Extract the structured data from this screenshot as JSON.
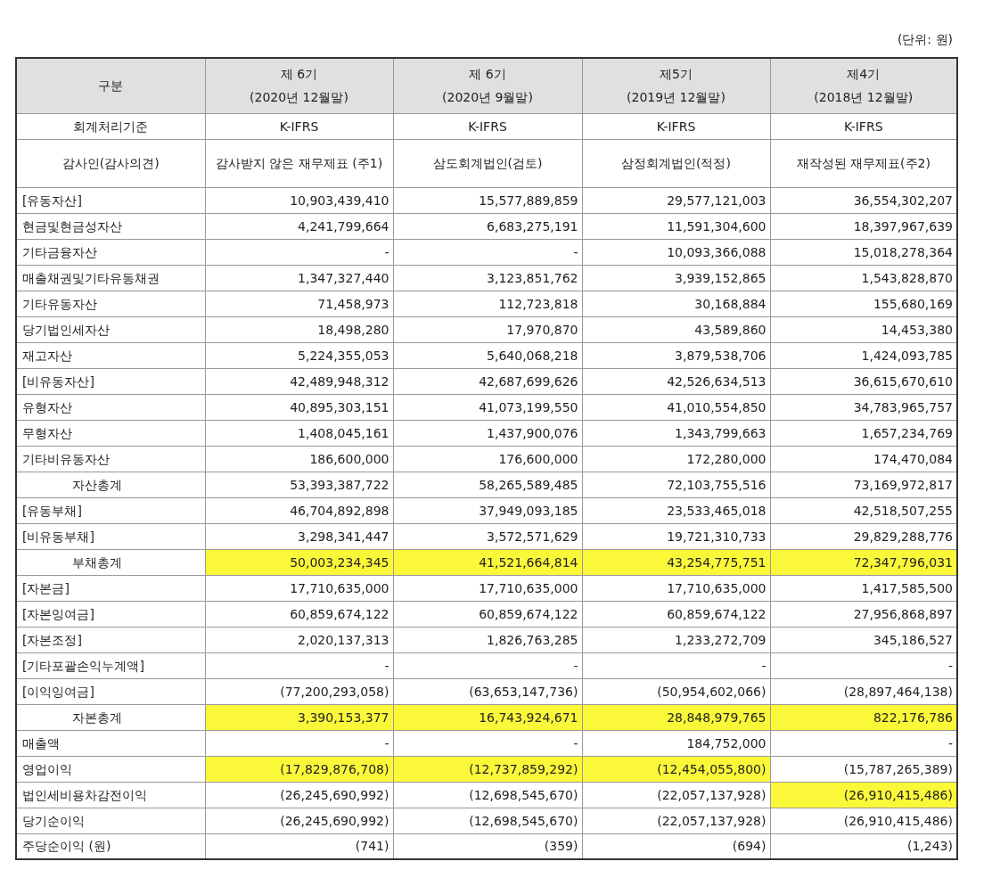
{
  "unit_note": "(단위: 원)",
  "columns": [
    {
      "label": "구분"
    },
    {
      "period": "제 6기",
      "date": "(2020년 12월말)"
    },
    {
      "period": "제 6기",
      "date": "(2020년 9월말)"
    },
    {
      "period": "제5기",
      "date": "(2019년 12월말)"
    },
    {
      "period": "제4기",
      "date": "(2018년 12월말)"
    }
  ],
  "rows": [
    {
      "kind": "info",
      "label": "회계처리기준",
      "cells": [
        {
          "text": "K-IFRS",
          "highlighted": false
        },
        {
          "text": "K-IFRS",
          "highlighted": false
        },
        {
          "text": "K-IFRS",
          "highlighted": false
        },
        {
          "text": "K-IFRS",
          "highlighted": false
        }
      ]
    },
    {
      "kind": "info",
      "label": "감사인(감사의견)",
      "cells": [
        {
          "text": "감사받지 않은 재무제표 (주1)",
          "highlighted": false
        },
        {
          "text": "삼도회계법인(검토)",
          "highlighted": false
        },
        {
          "text": "삼정회계법인(적정)",
          "highlighted": false
        },
        {
          "text": "재작성된 재무제표(주2)",
          "highlighted": false
        }
      ]
    },
    {
      "kind": "item",
      "label": "[유동자산]",
      "cells": [
        {
          "text": "10,903,439,410",
          "highlighted": false
        },
        {
          "text": "15,577,889,859",
          "highlighted": false
        },
        {
          "text": "29,577,121,003",
          "highlighted": false
        },
        {
          "text": "36,554,302,207",
          "highlighted": false
        }
      ]
    },
    {
      "kind": "item",
      "label": "현금및현금성자산",
      "cells": [
        {
          "text": "4,241,799,664",
          "highlighted": false
        },
        {
          "text": "6,683,275,191",
          "highlighted": false
        },
        {
          "text": "11,591,304,600",
          "highlighted": false
        },
        {
          "text": "18,397,967,639",
          "highlighted": false
        }
      ]
    },
    {
      "kind": "item",
      "label": "기타금융자산",
      "cells": [
        {
          "text": "-",
          "highlighted": false
        },
        {
          "text": "-",
          "highlighted": false
        },
        {
          "text": "10,093,366,088",
          "highlighted": false
        },
        {
          "text": "15,018,278,364",
          "highlighted": false
        }
      ]
    },
    {
      "kind": "item",
      "label": "매출채권및기타유동채권",
      "cells": [
        {
          "text": "1,347,327,440",
          "highlighted": false
        },
        {
          "text": "3,123,851,762",
          "highlighted": false
        },
        {
          "text": "3,939,152,865",
          "highlighted": false
        },
        {
          "text": "1,543,828,870",
          "highlighted": false
        }
      ]
    },
    {
      "kind": "item",
      "label": "기타유동자산",
      "cells": [
        {
          "text": "71,458,973",
          "highlighted": false
        },
        {
          "text": "112,723,818",
          "highlighted": false
        },
        {
          "text": "30,168,884",
          "highlighted": false
        },
        {
          "text": "155,680,169",
          "highlighted": false
        }
      ]
    },
    {
      "kind": "item",
      "label": "당기법인세자산",
      "cells": [
        {
          "text": "18,498,280",
          "highlighted": false
        },
        {
          "text": "17,970,870",
          "highlighted": false
        },
        {
          "text": "43,589,860",
          "highlighted": false
        },
        {
          "text": "14,453,380",
          "highlighted": false
        }
      ]
    },
    {
      "kind": "item",
      "label": "재고자산",
      "cells": [
        {
          "text": "5,224,355,053",
          "highlighted": false
        },
        {
          "text": "5,640,068,218",
          "highlighted": false
        },
        {
          "text": "3,879,538,706",
          "highlighted": false
        },
        {
          "text": "1,424,093,785",
          "highlighted": false
        }
      ]
    },
    {
      "kind": "item",
      "label": "[비유동자산]",
      "cells": [
        {
          "text": "42,489,948,312",
          "highlighted": false
        },
        {
          "text": "42,687,699,626",
          "highlighted": false
        },
        {
          "text": "42,526,634,513",
          "highlighted": false
        },
        {
          "text": "36,615,670,610",
          "highlighted": false
        }
      ]
    },
    {
      "kind": "item",
      "label": "유형자산",
      "cells": [
        {
          "text": "40,895,303,151",
          "highlighted": false
        },
        {
          "text": "41,073,199,550",
          "highlighted": false
        },
        {
          "text": "41,010,554,850",
          "highlighted": false
        },
        {
          "text": "34,783,965,757",
          "highlighted": false
        }
      ]
    },
    {
      "kind": "item",
      "label": "무형자산",
      "cells": [
        {
          "text": "1,408,045,161",
          "highlighted": false
        },
        {
          "text": "1,437,900,076",
          "highlighted": false
        },
        {
          "text": "1,343,799,663",
          "highlighted": false
        },
        {
          "text": "1,657,234,769",
          "highlighted": false
        }
      ]
    },
    {
      "kind": "item",
      "label": "기타비유동자산",
      "cells": [
        {
          "text": "186,600,000",
          "highlighted": false
        },
        {
          "text": "176,600,000",
          "highlighted": false
        },
        {
          "text": "172,280,000",
          "highlighted": false
        },
        {
          "text": "174,470,084",
          "highlighted": false
        }
      ]
    },
    {
      "kind": "total",
      "label": "자산총계",
      "cells": [
        {
          "text": "53,393,387,722",
          "highlighted": false
        },
        {
          "text": "58,265,589,485",
          "highlighted": false
        },
        {
          "text": "72,103,755,516",
          "highlighted": false
        },
        {
          "text": "73,169,972,817",
          "highlighted": false
        }
      ]
    },
    {
      "kind": "item",
      "label": "[유동부채]",
      "cells": [
        {
          "text": "46,704,892,898",
          "highlighted": false
        },
        {
          "text": "37,949,093,185",
          "highlighted": false
        },
        {
          "text": "23,533,465,018",
          "highlighted": false
        },
        {
          "text": "42,518,507,255",
          "highlighted": false
        }
      ]
    },
    {
      "kind": "item",
      "label": "[비유동부채]",
      "cells": [
        {
          "text": "3,298,341,447",
          "highlighted": false
        },
        {
          "text": "3,572,571,629",
          "highlighted": false
        },
        {
          "text": "19,721,310,733",
          "highlighted": false
        },
        {
          "text": "29,829,288,776",
          "highlighted": false
        }
      ]
    },
    {
      "kind": "total",
      "label": "부채총계",
      "cells": [
        {
          "text": "50,003,234,345",
          "highlighted": true
        },
        {
          "text": "41,521,664,814",
          "highlighted": true
        },
        {
          "text": "43,254,775,751",
          "highlighted": true
        },
        {
          "text": "72,347,796,031",
          "highlighted": true
        }
      ]
    },
    {
      "kind": "item",
      "label": "[자본금]",
      "cells": [
        {
          "text": "17,710,635,000",
          "highlighted": false
        },
        {
          "text": "17,710,635,000",
          "highlighted": false
        },
        {
          "text": "17,710,635,000",
          "highlighted": false
        },
        {
          "text": "1,417,585,500",
          "highlighted": false
        }
      ]
    },
    {
      "kind": "item",
      "label": "[자본잉여금]",
      "cells": [
        {
          "text": "60,859,674,122",
          "highlighted": false
        },
        {
          "text": "60,859,674,122",
          "highlighted": false
        },
        {
          "text": "60,859,674,122",
          "highlighted": false
        },
        {
          "text": "27,956,868,897",
          "highlighted": false
        }
      ]
    },
    {
      "kind": "item",
      "label": "[자본조정]",
      "cells": [
        {
          "text": "2,020,137,313",
          "highlighted": false
        },
        {
          "text": "1,826,763,285",
          "highlighted": false
        },
        {
          "text": "1,233,272,709",
          "highlighted": false
        },
        {
          "text": "345,186,527",
          "highlighted": false
        }
      ]
    },
    {
      "kind": "item",
      "label": "[기타포괄손익누계액]",
      "cells": [
        {
          "text": "-",
          "highlighted": false
        },
        {
          "text": "-",
          "highlighted": false
        },
        {
          "text": "-",
          "highlighted": false
        },
        {
          "text": "-",
          "highlighted": false
        }
      ]
    },
    {
      "kind": "item",
      "label": "[이익잉여금]",
      "cells": [
        {
          "text": "(77,200,293,058)",
          "highlighted": false
        },
        {
          "text": "(63,653,147,736)",
          "highlighted": false
        },
        {
          "text": "(50,954,602,066)",
          "highlighted": false
        },
        {
          "text": "(28,897,464,138)",
          "highlighted": false
        }
      ]
    },
    {
      "kind": "total",
      "label": "자본총계",
      "cells": [
        {
          "text": "3,390,153,377",
          "highlighted": true
        },
        {
          "text": "16,743,924,671",
          "highlighted": true
        },
        {
          "text": "28,848,979,765",
          "highlighted": true
        },
        {
          "text": "822,176,786",
          "highlighted": true
        }
      ]
    },
    {
      "kind": "item",
      "label": "매출액",
      "cells": [
        {
          "text": "-",
          "highlighted": false
        },
        {
          "text": "-",
          "highlighted": false
        },
        {
          "text": "184,752,000",
          "highlighted": false
        },
        {
          "text": "-",
          "highlighted": false
        }
      ]
    },
    {
      "kind": "item",
      "label": "영업이익",
      "cells": [
        {
          "text": "(17,829,876,708)",
          "highlighted": true
        },
        {
          "text": "(12,737,859,292)",
          "highlighted": true
        },
        {
          "text": "(12,454,055,800)",
          "highlighted": true
        },
        {
          "text": "(15,787,265,389)",
          "highlighted": false
        }
      ]
    },
    {
      "kind": "item",
      "label": "법인세비용차감전이익",
      "cells": [
        {
          "text": "(26,245,690,992)",
          "highlighted": false
        },
        {
          "text": "(12,698,545,670)",
          "highlighted": false
        },
        {
          "text": "(22,057,137,928)",
          "highlighted": false
        },
        {
          "text": "(26,910,415,486)",
          "highlighted": true
        }
      ]
    },
    {
      "kind": "item",
      "label": "당기순이익",
      "cells": [
        {
          "text": "(26,245,690,992)",
          "highlighted": false
        },
        {
          "text": "(12,698,545,670)",
          "highlighted": false
        },
        {
          "text": "(22,057,137,928)",
          "highlighted": false
        },
        {
          "text": "(26,910,415,486)",
          "highlighted": false
        }
      ]
    },
    {
      "kind": "item",
      "label": "주당순이익 (원)",
      "cells": [
        {
          "text": "(741)",
          "highlighted": false
        },
        {
          "text": "(359)",
          "highlighted": false
        },
        {
          "text": "(694)",
          "highlighted": false
        },
        {
          "text": "(1,243)",
          "highlighted": false
        }
      ]
    }
  ]
}
